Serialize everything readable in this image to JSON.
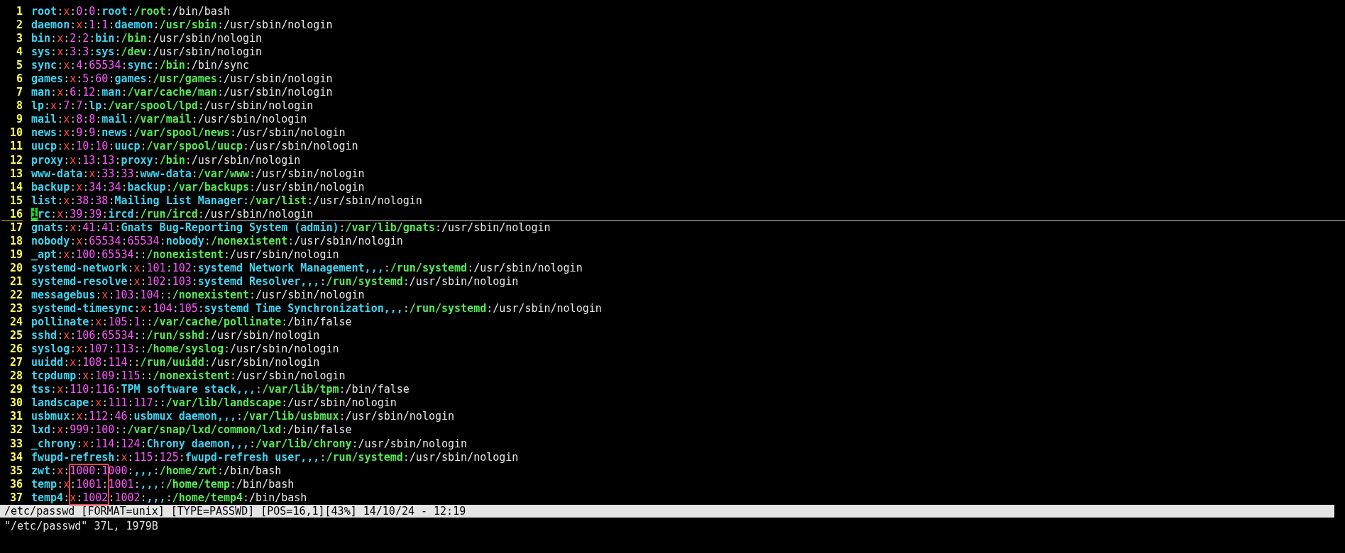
{
  "editor": {
    "lines": [
      {
        "number": "1",
        "text": "root:x:0:0:root:/root:/bin/bash",
        "cursor": false
      },
      {
        "number": "2",
        "text": "daemon:x:1:1:daemon:/usr/sbin:/usr/sbin/nologin",
        "cursor": false
      },
      {
        "number": "3",
        "text": "bin:x:2:2:bin:/bin:/usr/sbin/nologin",
        "cursor": false
      },
      {
        "number": "4",
        "text": "sys:x:3:3:sys:/dev:/usr/sbin/nologin",
        "cursor": false
      },
      {
        "number": "5",
        "text": "sync:x:4:65534:sync:/bin:/bin/sync",
        "cursor": false
      },
      {
        "number": "6",
        "text": "games:x:5:60:games:/usr/games:/usr/sbin/nologin",
        "cursor": false
      },
      {
        "number": "7",
        "text": "man:x:6:12:man:/var/cache/man:/usr/sbin/nologin",
        "cursor": false
      },
      {
        "number": "8",
        "text": "lp:x:7:7:lp:/var/spool/lpd:/usr/sbin/nologin",
        "cursor": false
      },
      {
        "number": "9",
        "text": "mail:x:8:8:mail:/var/mail:/usr/sbin/nologin",
        "cursor": false
      },
      {
        "number": "10",
        "text": "news:x:9:9:news:/var/spool/news:/usr/sbin/nologin",
        "cursor": false
      },
      {
        "number": "11",
        "text": "uucp:x:10:10:uucp:/var/spool/uucp:/usr/sbin/nologin",
        "cursor": false
      },
      {
        "number": "12",
        "text": "proxy:x:13:13:proxy:/bin:/usr/sbin/nologin",
        "cursor": false
      },
      {
        "number": "13",
        "text": "www-data:x:33:33:www-data:/var/www:/usr/sbin/nologin",
        "cursor": false
      },
      {
        "number": "14",
        "text": "backup:x:34:34:backup:/var/backups:/usr/sbin/nologin",
        "cursor": false
      },
      {
        "number": "15",
        "text": "list:x:38:38:Mailing List Manager:/var/list:/usr/sbin/nologin",
        "cursor": false
      },
      {
        "number": "16",
        "text": "irc:x:39:39:ircd:/run/ircd:/usr/sbin/nologin",
        "cursor": true
      },
      {
        "number": "17",
        "text": "gnats:x:41:41:Gnats Bug-Reporting System (admin):/var/lib/gnats:/usr/sbin/nologin",
        "cursor": false
      },
      {
        "number": "18",
        "text": "nobody:x:65534:65534:nobody:/nonexistent:/usr/sbin/nologin",
        "cursor": false
      },
      {
        "number": "19",
        "text": "_apt:x:100:65534::/nonexistent:/usr/sbin/nologin",
        "cursor": false
      },
      {
        "number": "20",
        "text": "systemd-network:x:101:102:systemd Network Management,,,:/run/systemd:/usr/sbin/nologin",
        "cursor": false
      },
      {
        "number": "21",
        "text": "systemd-resolve:x:102:103:systemd Resolver,,,:/run/systemd:/usr/sbin/nologin",
        "cursor": false
      },
      {
        "number": "22",
        "text": "messagebus:x:103:104::/nonexistent:/usr/sbin/nologin",
        "cursor": false
      },
      {
        "number": "23",
        "text": "systemd-timesync:x:104:105:systemd Time Synchronization,,,:/run/systemd:/usr/sbin/nologin",
        "cursor": false
      },
      {
        "number": "24",
        "text": "pollinate:x:105:1::/var/cache/pollinate:/bin/false",
        "cursor": false
      },
      {
        "number": "25",
        "text": "sshd:x:106:65534::/run/sshd:/usr/sbin/nologin",
        "cursor": false
      },
      {
        "number": "26",
        "text": "syslog:x:107:113::/home/syslog:/usr/sbin/nologin",
        "cursor": false
      },
      {
        "number": "27",
        "text": "uuidd:x:108:114::/run/uuidd:/usr/sbin/nologin",
        "cursor": false
      },
      {
        "number": "28",
        "text": "tcpdump:x:109:115::/nonexistent:/usr/sbin/nologin",
        "cursor": false
      },
      {
        "number": "29",
        "text": "tss:x:110:116:TPM software stack,,,:/var/lib/tpm:/bin/false",
        "cursor": false
      },
      {
        "number": "30",
        "text": "landscape:x:111:117::/var/lib/landscape:/usr/sbin/nologin",
        "cursor": false
      },
      {
        "number": "31",
        "text": "usbmux:x:112:46:usbmux daemon,,,:/var/lib/usbmux:/usr/sbin/nologin",
        "cursor": false
      },
      {
        "number": "32",
        "text": "lxd:x:999:100::/var/snap/lxd/common/lxd:/bin/false",
        "cursor": false
      },
      {
        "number": "33",
        "text": "_chrony:x:114:124:Chrony daemon,,,:/var/lib/chrony:/usr/sbin/nologin",
        "cursor": false
      },
      {
        "number": "34",
        "text": "fwupd-refresh:x:115:125:fwupd-refresh user,,,:/run/systemd:/usr/sbin/nologin",
        "cursor": false
      },
      {
        "number": "35",
        "text": "zwt:x:1000:1000:,,,:/home/zwt:/bin/bash",
        "cursor": false
      },
      {
        "number": "36",
        "text": "temp:x:1001:1001:,,,:/home/temp:/bin/bash",
        "cursor": false
      },
      {
        "number": "37",
        "text": "temp4:x:1002:1002:,,,:/home/temp4:/bin/bash",
        "cursor": false
      }
    ],
    "annotation": {
      "kind": "rectangle"
    }
  },
  "status_line": "/etc/passwd [FORMAT=unix] [TYPE=PASSWD] [POS=16,1][43%] 14/10/24 - 12:19",
  "message": "\"/etc/passwd\" 37L, 1979B"
}
